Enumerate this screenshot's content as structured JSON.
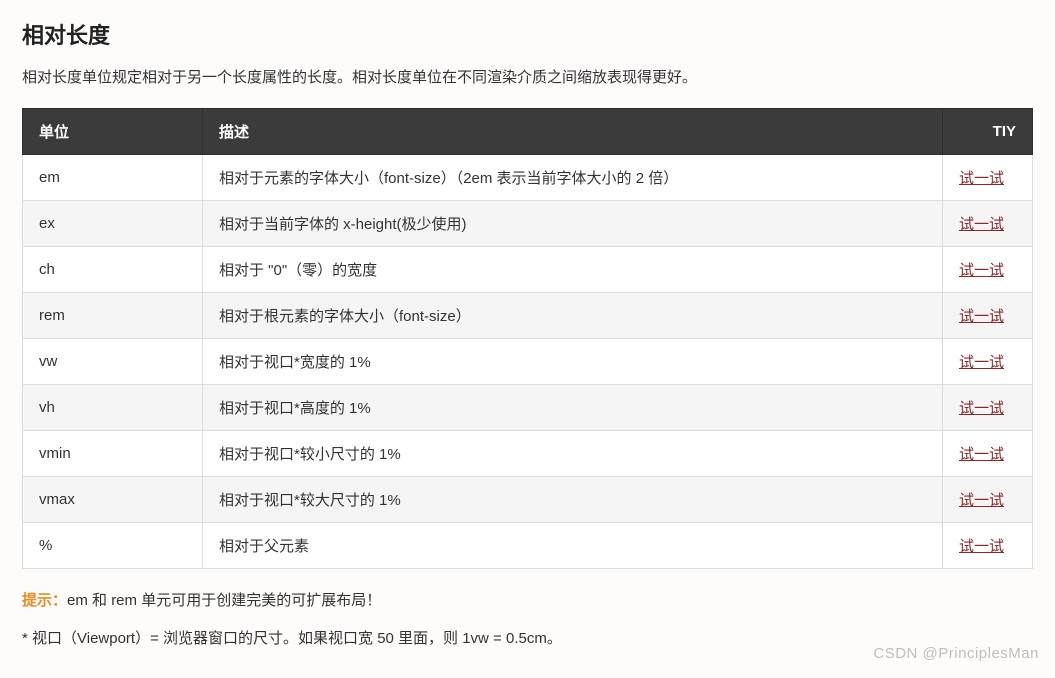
{
  "heading": "相对长度",
  "intro": "相对长度单位规定相对于另一个长度属性的长度。相对长度单位在不同渲染介质之间缩放表现得更好。",
  "table": {
    "headers": {
      "unit": "单位",
      "desc": "描述",
      "tiy": "TIY"
    },
    "rows": [
      {
        "unit": "em",
        "desc": "相对于元素的字体大小（font-size）（2em 表示当前字体大小的 2 倍）",
        "tiy": "试一试"
      },
      {
        "unit": "ex",
        "desc": "相对于当前字体的 x-height(极少使用)",
        "tiy": "试一试"
      },
      {
        "unit": "ch",
        "desc": "相对于 \"0\"（零）的宽度",
        "tiy": "试一试"
      },
      {
        "unit": "rem",
        "desc": "相对于根元素的字体大小（font-size）",
        "tiy": "试一试"
      },
      {
        "unit": "vw",
        "desc": "相对于视口*宽度的 1%",
        "tiy": "试一试"
      },
      {
        "unit": "vh",
        "desc": "相对于视口*高度的 1%",
        "tiy": "试一试"
      },
      {
        "unit": "vmin",
        "desc": "相对于视口*较小尺寸的 1%",
        "tiy": "试一试"
      },
      {
        "unit": "vmax",
        "desc": "相对于视口*较大尺寸的 1%",
        "tiy": "试一试"
      },
      {
        "unit": "%",
        "desc": "相对于父元素",
        "tiy": "试一试"
      }
    ]
  },
  "tip": {
    "label": "提示：",
    "text": "em 和 rem 单元可用于创建完美的可扩展布局！"
  },
  "footnote": "* 视口（Viewport）= 浏览器窗口的尺寸。如果视口宽 50 里面，则 1vw = 0.5cm。",
  "watermark": "CSDN @PrinciplesMan"
}
